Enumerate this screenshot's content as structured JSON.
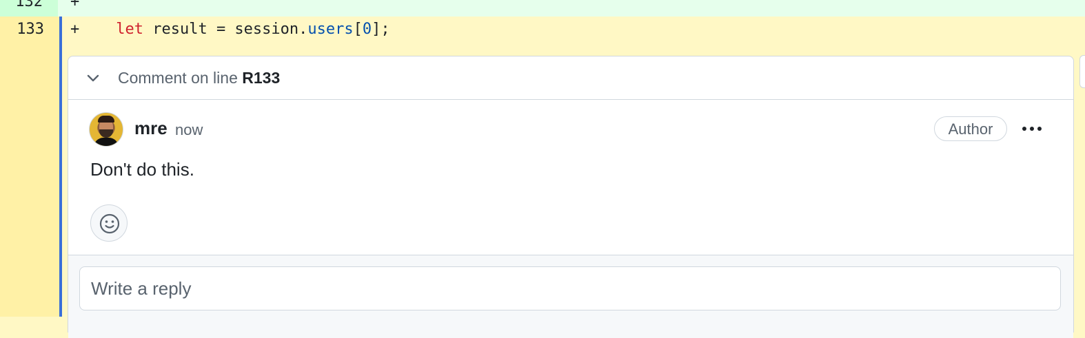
{
  "diff": {
    "prev_line": {
      "number": "132",
      "sign": "+"
    },
    "current_line": {
      "number": "133",
      "sign": "+",
      "code": {
        "indent": "    ",
        "keyword": "let",
        "pre": " result = session.",
        "property": "users",
        "open": "[",
        "index": "0",
        "close": "];"
      }
    }
  },
  "thread": {
    "header_prefix": "Comment on line",
    "line_ref": "R133",
    "collapse_icon": "chevron-down-icon"
  },
  "comment": {
    "author": "mre",
    "time": "now",
    "badge": "Author",
    "more_icon": "kebab-horizontal-icon",
    "body": "Don't do this.",
    "reaction_icon": "smiley-icon"
  },
  "reply": {
    "placeholder": "Write a reply"
  },
  "colors": {
    "added_line_bg": "#e6ffec",
    "selected_line_bg": "#fff8c5",
    "gutter_selected": "#fff1a6",
    "selection_marker": "#3a6fd8",
    "keyword": "#cf222e",
    "property": "#0550ae"
  }
}
